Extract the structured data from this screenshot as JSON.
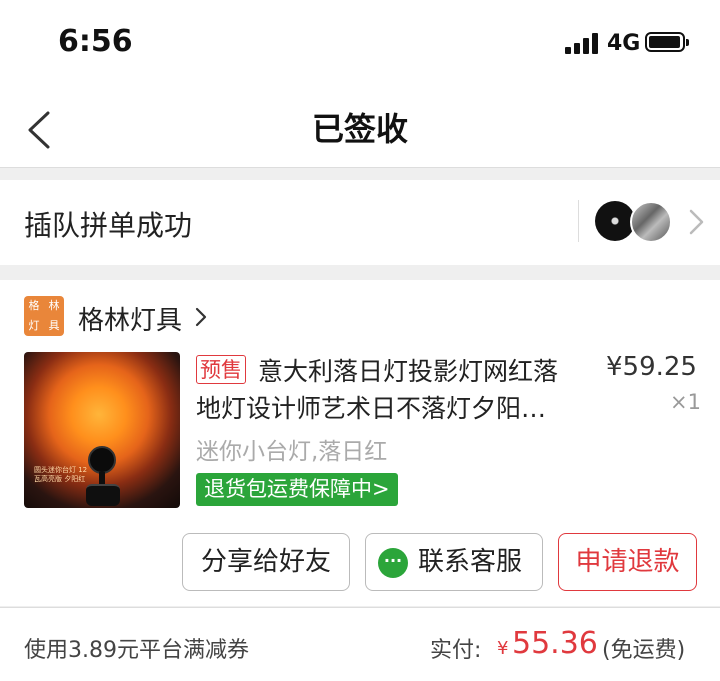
{
  "status_bar": {
    "time": "6:56",
    "network": "4G"
  },
  "nav": {
    "title": "已签收"
  },
  "group": {
    "text": "插队拼单成功"
  },
  "shop": {
    "logo_chars": [
      "格",
      "林",
      "灯",
      "具"
    ],
    "name": "格林灯具"
  },
  "product": {
    "presale_badge": "预售",
    "title_line1": "意大利落日灯投影灯网红落",
    "title_line2": "地灯设计师艺术日不落灯夕阳…",
    "price": "¥59.25",
    "quantity": "×1",
    "spec": "迷你小台灯,落日红",
    "guarantee": "退货包运费保障中>",
    "image_caption": "圆头迷你台灯 12瓦高亮版 夕阳红"
  },
  "actions": {
    "share_label": "分享给好友",
    "contact_label": "联系客服",
    "refund_label": "申请退款"
  },
  "footer": {
    "coupon_text": "使用3.89元平台满减券",
    "paid_label": "实付:",
    "currency": "¥",
    "paid_amount": "55.36",
    "shipping_note": "(免运费)"
  },
  "colors": {
    "accent_red": "#e0393e",
    "guarantee_green": "#2ba53a",
    "shop_logo_orange": "#e9863a"
  },
  "icons": [
    "back-chevron-icon",
    "signal-icon",
    "battery-icon",
    "chevron-right-icon",
    "wechat-icon"
  ]
}
